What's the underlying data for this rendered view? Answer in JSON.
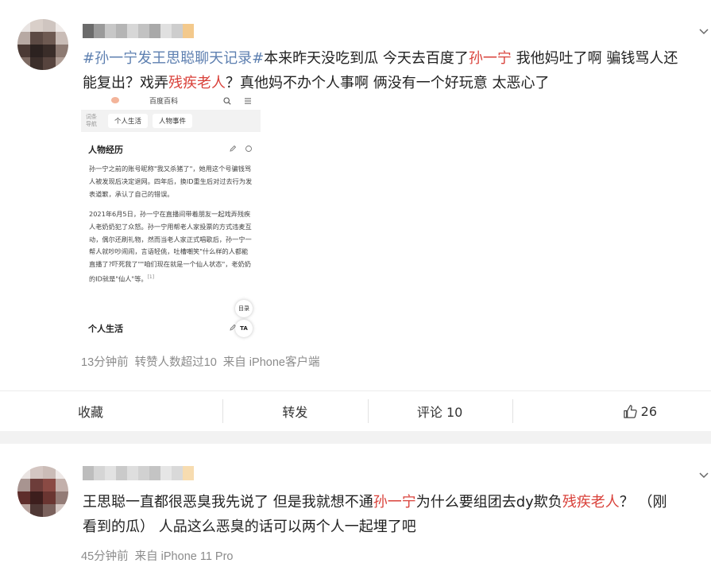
{
  "post": {
    "hashtag": "#孙一宁发王思聪聊天记录#",
    "text_seg1": "本来昨天没吃到瓜 今天去百度了",
    "name_1": "孙一宁",
    "text_seg2": " 我他妈吐了啊 骗钱骂人还",
    "text_seg3": "能复出？戏弄",
    "phrase_1": "残疾老人",
    "text_seg4": "？真他妈不办个人事啊 俩没有一个好玩意 太恶心了",
    "meta": {
      "time": "13分钟前",
      "reposts": "转赞人数超过10",
      "source": "来自 iPhone客户端"
    },
    "screenshot": {
      "app_title": "百度百科",
      "nav_label_1": "词条",
      "nav_label_2": "导航",
      "tab_1": "个人生活",
      "tab_2": "人物事件",
      "section_1": "人物经历",
      "para_1": "孙一宁之前的账号昵称\"我又杀猪了\"，她用这个号骗钱骂人被发现后决定退网。四年后，换ID重生后对过去行为发表道歉，承认了自己的错误。",
      "para_2": "2021年6月5日，孙一宁在直播间带着朋友一起戏弄残疾人老奶奶犯了众怒。孙一宁用帮老人家投票的方式违麦互动，偶尔还刷礼物，然而当老人家正式唱歌后，孙一宁一帮人就吵吵闹闹，言语轻佻，吐槽嘲笑\"什么样的人都能直播了?吓死我了\"\"咱们现在就是一个仙人状态\"，老奶奶的ID就是\"仙人\"等。",
      "ref": "[1]",
      "toc_btn": "目录",
      "section_2": "个人生活",
      "ta_btn": "TA"
    }
  },
  "actions": {
    "favorite": "收藏",
    "repost": "转发",
    "comment": "评论 10",
    "like_count": "26"
  },
  "comment": {
    "text_seg1": "王思聪一直都很恶臭我先说了 但是我就想不通",
    "name_1": "孙一宁",
    "text_seg2": "为什么要组团去dy欺负",
    "phrase_1": "残疾老人",
    "text_seg3": "？ （刚",
    "text_seg4": "看到的瓜） 人品这么恶臭的话可以两个人一起埋了吧",
    "meta": {
      "time": "45分钟前",
      "source": "来自 iPhone 11 Pro"
    }
  },
  "icons": {
    "chevron": "chevron-down-icon",
    "like": "thumbs-up-icon",
    "edit": "pencil-icon",
    "more": "more-icon",
    "search": "search-icon",
    "menu": "menu-icon"
  },
  "colors": {
    "hashtag": "#5d7fb0",
    "highlight": "#d9413a",
    "meta": "#8b8b8b",
    "divider": "#f2f2f2"
  }
}
